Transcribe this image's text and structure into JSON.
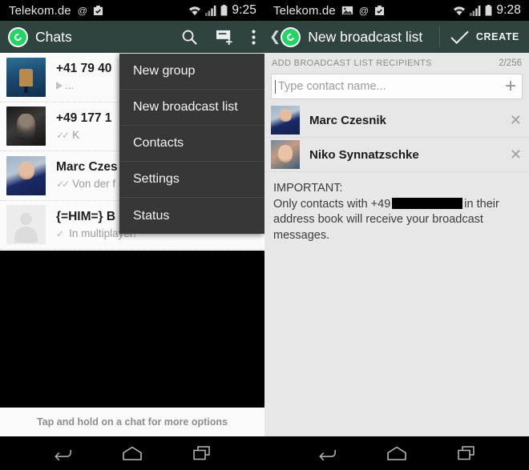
{
  "left": {
    "statusbar": {
      "carrier": "Telekom.de",
      "icons": [
        "at-icon",
        "screenshot-icon"
      ],
      "right_icons": [
        "wifi-icon",
        "signal-icon",
        "battery-icon"
      ],
      "time": "9:25"
    },
    "actionbar": {
      "logo": "whatsapp-logo-icon",
      "title": "Chats",
      "actions": [
        "search-icon",
        "new-chat-icon",
        "overflow-menu-icon"
      ]
    },
    "chats": [
      {
        "title": "+41 79 40",
        "preview": "...",
        "marker": "play-icon",
        "avatar": "a1"
      },
      {
        "title": "+49 177 1",
        "preview": "K",
        "marker": "double-check-icon",
        "avatar": "a2"
      },
      {
        "title": "Marc Czes",
        "preview": "Von der f",
        "marker": "double-check-icon",
        "avatar": "a3"
      },
      {
        "title": "{=HIM=} B",
        "preview": "In multiplayer!",
        "marker": "single-check-icon",
        "avatar": "a4"
      }
    ],
    "hint": "Tap and hold on a chat for more options"
  },
  "menu": {
    "items": [
      {
        "label": "New group"
      },
      {
        "label": "New broadcast list"
      },
      {
        "label": "Contacts"
      },
      {
        "label": "Settings"
      },
      {
        "label": "Status"
      }
    ]
  },
  "right": {
    "statusbar": {
      "carrier": "Telekom.de",
      "icons": [
        "image-icon",
        "at-icon",
        "screenshot-icon"
      ],
      "right_icons": [
        "wifi-icon",
        "signal-icon",
        "battery-icon"
      ],
      "time": "9:28"
    },
    "actionbar": {
      "back": "back-chevron-icon",
      "logo": "whatsapp-logo-icon",
      "title": "New broadcast list",
      "check": "check-icon",
      "create_label": "CREATE"
    },
    "section": {
      "label": "ADD BROADCAST LIST RECIPIENTS",
      "count": "2/256"
    },
    "search": {
      "placeholder": "Type contact name...",
      "add_icon": "plus-icon"
    },
    "recipients": [
      {
        "name": "Marc Czesnik",
        "remove": "close-icon",
        "avatar": "r1"
      },
      {
        "name": "Niko Synnatzschke",
        "remove": "close-icon",
        "avatar": "r2"
      }
    ],
    "important": {
      "heading": "IMPORTANT:",
      "line_before": "Only contacts with +49",
      "redacted": "",
      "line_after": "in their address book will receive your broadcast messages."
    }
  },
  "navbar": {
    "buttons": [
      "back-icon",
      "home-icon",
      "recents-icon"
    ]
  },
  "colors": {
    "accent": "#2f443f",
    "whatsapp_green": "#25d366",
    "menu_bg": "#373737",
    "panel_bg": "#e7e7e7",
    "list_bg": "#fbfbfb"
  }
}
